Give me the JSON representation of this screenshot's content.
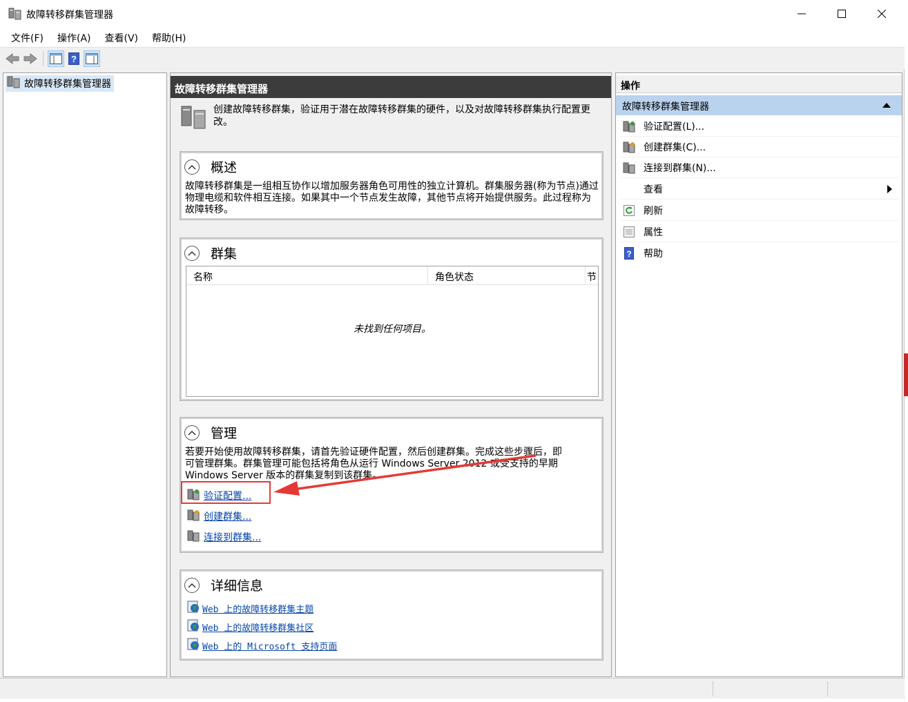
{
  "window": {
    "title": "故障转移群集管理器",
    "app_icon": "cluster-manager-icon"
  },
  "menu": [
    "文件(F)",
    "操作(A)",
    "查看(V)",
    "帮助(H)"
  ],
  "toolbar": {
    "buttons": [
      "back-arrow-icon",
      "forward-arrow-icon",
      "show-hide-tree-icon",
      "help-icon",
      "show-hide-action-pane-icon"
    ]
  },
  "tree": {
    "root_label": "故障转移群集管理器"
  },
  "center": {
    "header": "故障转移群集管理器",
    "intro": "创建故障转移群集，验证用于潜在故障转移群集的硬件，以及对故障转移群集执行配置更改。",
    "overview": {
      "title": "概述",
      "text": "故障转移群集是一组相互协作以增加服务器角色可用性的独立计算机。群集服务器(称为节点)通过物理电缆和软件相互连接。如果其中一个节点发生故障，其他节点将开始提供服务。此过程称为故障转移。"
    },
    "clusters": {
      "title": "群集",
      "columns": [
        "名称",
        "角色状态",
        "节"
      ],
      "empty_text": "未找到任何项目。"
    },
    "management": {
      "title": "管理",
      "text_line1": "若要开始使用故障转移群集，请首先验证硬件配置，然后创建群集。完成这些步骤后，即",
      "text_line2": "可管理群集。群集管理可能包括将角色从运行 Windows Server 2012 或受支持的早期",
      "text_line3": "Windows Server 版本的群集复制到该群集。",
      "links": [
        "验证配置...",
        "创建群集...",
        "连接到群集..."
      ]
    },
    "details": {
      "title": "详细信息",
      "links": [
        "Web 上的故障转移群集主题",
        "Web 上的故障转移群集社区",
        "Web 上的 Microsoft 支持页面"
      ]
    }
  },
  "actions": {
    "header": "操作",
    "section": "故障转移群集管理器",
    "items": [
      "验证配置(L)...",
      "创建群集(C)...",
      "连接到群集(N)...",
      "查看",
      "刷新",
      "属性",
      "帮助"
    ]
  },
  "colors": {
    "header_bg": "#3c3c3c",
    "section_bg": "#b9d3ee",
    "link": "#0645ad",
    "annotation_red": "#e53935"
  }
}
